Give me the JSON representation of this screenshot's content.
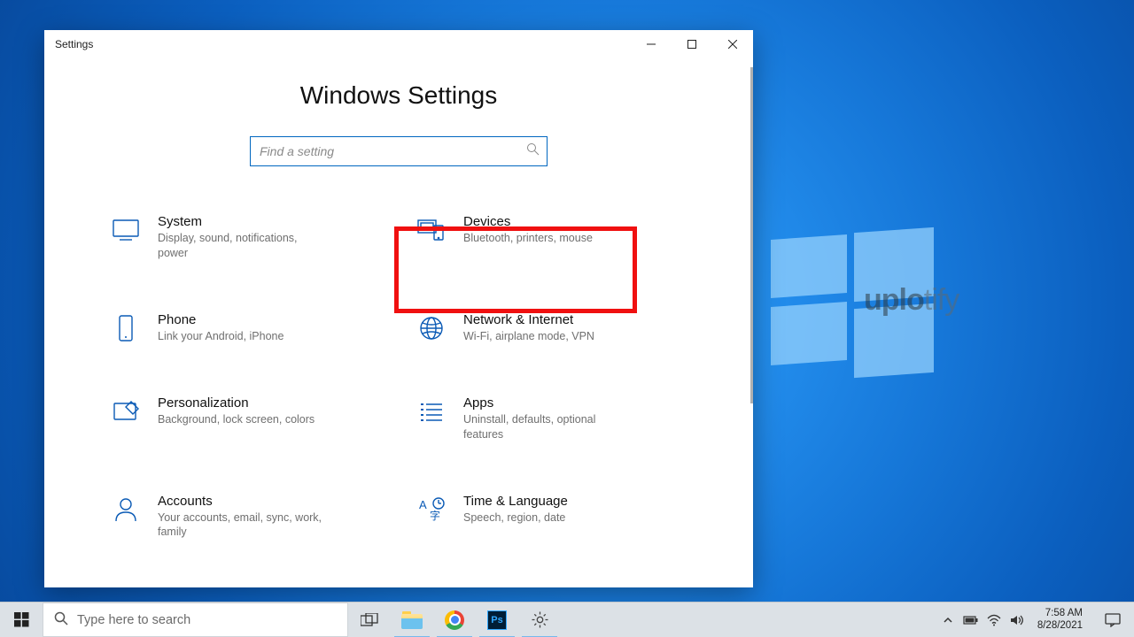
{
  "window": {
    "title": "Settings",
    "page_title": "Windows Settings",
    "search_placeholder": "Find a setting"
  },
  "categories": [
    {
      "id": "system",
      "title": "System",
      "desc": "Display, sound, notifications, power"
    },
    {
      "id": "devices",
      "title": "Devices",
      "desc": "Bluetooth, printers, mouse"
    },
    {
      "id": "phone",
      "title": "Phone",
      "desc": "Link your Android, iPhone"
    },
    {
      "id": "network",
      "title": "Network & Internet",
      "desc": "Wi-Fi, airplane mode, VPN"
    },
    {
      "id": "personalization",
      "title": "Personalization",
      "desc": "Background, lock screen, colors"
    },
    {
      "id": "apps",
      "title": "Apps",
      "desc": "Uninstall, defaults, optional features"
    },
    {
      "id": "accounts",
      "title": "Accounts",
      "desc": "Your accounts, email, sync, work, family"
    },
    {
      "id": "time",
      "title": "Time & Language",
      "desc": "Speech, region, date"
    }
  ],
  "highlighted_category": "devices",
  "taskbar": {
    "search_placeholder": "Type here to search",
    "clock_time": "7:58 AM",
    "clock_date": "8/28/2021",
    "ps_label": "Ps"
  },
  "watermark": {
    "bold": "uplo",
    "light": "tify"
  }
}
